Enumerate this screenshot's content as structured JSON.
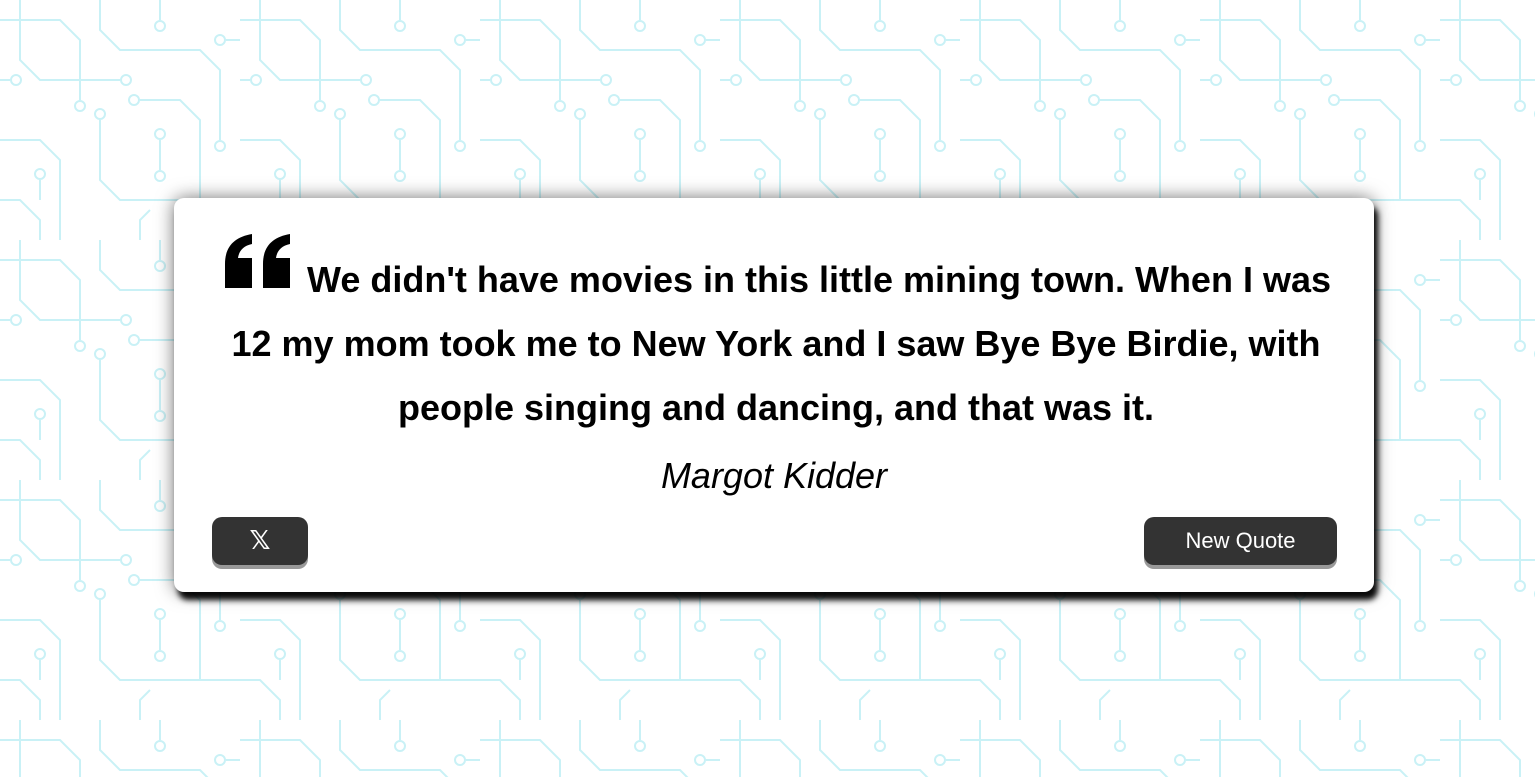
{
  "quote": {
    "text": "We didn't have movies in this little mining town. When I was 12 my mom took me to New York and I saw Bye Bye Birdie, with people singing and dancing, and that was it.",
    "author": "Margot Kidder",
    "icon": "quote-left-icon"
  },
  "actions": {
    "tweet_icon_glyph": "𝕏",
    "tweet_icon": "x-logo-icon",
    "new_quote_label": "New Quote"
  },
  "colors": {
    "background": "#ffffff",
    "pattern": "#c9f1f6",
    "card": "#ffffff",
    "button": "#333333",
    "button_text": "#ffffff"
  }
}
